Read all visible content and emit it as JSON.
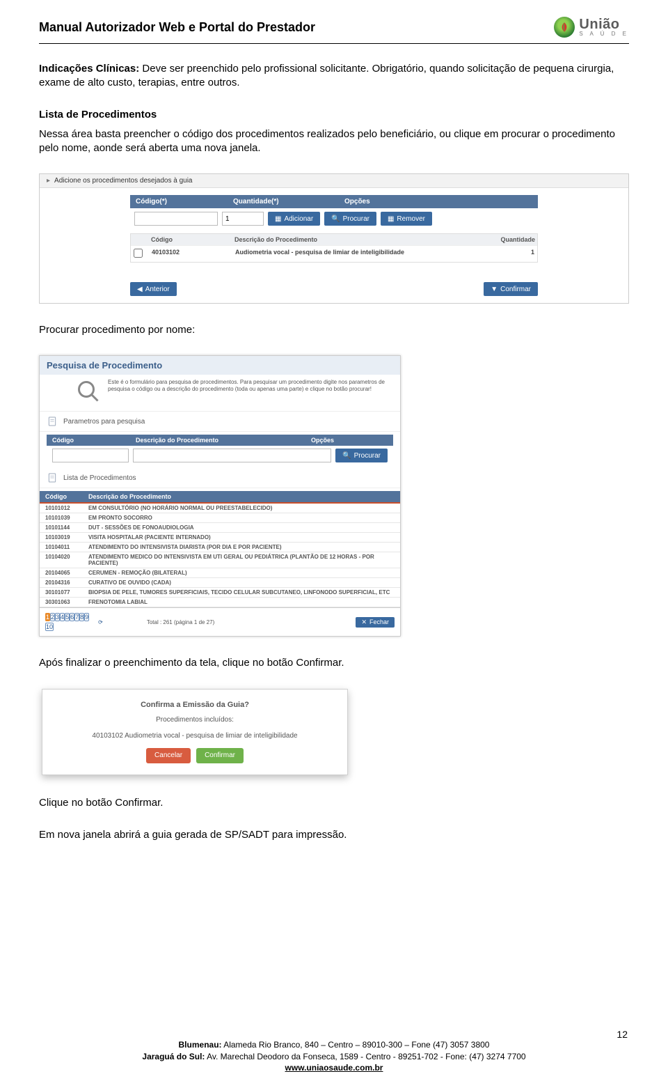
{
  "header": {
    "title": "Manual Autorizador Web e Portal do Prestador",
    "brand_name": "União",
    "brand_sub": "S A Ú D E"
  },
  "para1": {
    "label": "Indicações Clínicas:",
    "text": " Deve ser preenchido pelo profissional solicitante. Obrigatório, quando solicitação de pequena cirurgia, exame de alto custo, terapias, entre outros."
  },
  "h_lista": "Lista de Procedimentos",
  "para2": "Nessa área basta preencher o código dos procedimentos realizados pelo beneficiário, ou clique em procurar o procedimento pelo nome, aonde será aberta uma nova janela.",
  "shot1": {
    "bar": "Adicione os procedimentos desejados à guia",
    "th_codigo": "Código(*)",
    "th_qtd": "Quantidade(*)",
    "th_opc": "Opções",
    "default_qty": "1",
    "btn_add": "Adicionar",
    "btn_search": "Procurar",
    "btn_remove": "Remover",
    "sub_h0": "",
    "sub_h1": "Código",
    "sub_h2": "Descrição do Procedimento",
    "sub_h3": "Quantidade",
    "row_code": "40103102",
    "row_desc": "Audiometria vocal - pesquisa de limiar de inteligibilidade",
    "row_qty": "1",
    "btn_prev": "Anterior",
    "btn_next": "Confirmar"
  },
  "h_proc": "Procurar procedimento por nome:",
  "shot2": {
    "title": "Pesquisa de Procedimento",
    "desc": "Este é o formulário para pesquisa de procedimentos. Para pesquisar um procedimento digite nos parametros de pesquisa o código ou a descrição do procedimento (toda ou apenas uma parte) e clique no botão procurar!",
    "sec_params": "Parametros para pesquisa",
    "fh_a": "Código",
    "fh_b": "Descrição do Procedimento",
    "fh_c": "Opções",
    "btn_filter_search": "Procurar",
    "sec_list": "Lista de Procedimentos",
    "th_a": "Código",
    "th_b": "Descrição do Procedimento",
    "rows": [
      {
        "c": "10101012",
        "d": "EM CONSULTÓRIO (NO HORÁRIO NORMAL OU PREESTABELECIDO)"
      },
      {
        "c": "10101039",
        "d": "EM PRONTO SOCORRO"
      },
      {
        "c": "10101144",
        "d": "DUT - SESSÕES DE FONOAUDIOLOGIA"
      },
      {
        "c": "10103019",
        "d": "VISITA HOSPITALAR (PACIENTE INTERNADO)"
      },
      {
        "c": "10104011",
        "d": "ATENDIMENTO DO INTENSIVISTA DIARISTA (POR DIA E POR PACIENTE)"
      },
      {
        "c": "10104020",
        "d": "ATENDIMENTO MEDICO DO INTENSIVISTA EM UTI GERAL OU PEDIÁTRICA (PLANTÃO DE 12 HORAS - POR PACIENTE)"
      },
      {
        "c": "20104065",
        "d": "CERUMEN - REMOÇÃO (BILATERAL)"
      },
      {
        "c": "20104316",
        "d": "CURATIVO DE OUVIDO (CADA)"
      },
      {
        "c": "30101077",
        "d": "BIOPSIA DE PELE, TUMORES SUPERFICIAIS, TECIDO CELULAR SUBCUTANEO, LINFONODO SUPERFICIAL, ETC"
      },
      {
        "c": "30301063",
        "d": "FRENOTOMIA LABIAL"
      }
    ],
    "pages": [
      "1",
      "2",
      "3",
      "4",
      "5",
      "6",
      "7",
      "8",
      "9",
      "10"
    ],
    "total": "Total : 261 (página 1 de 27)",
    "btn_close": "Fechar"
  },
  "para3": "Após finalizar o preenchimento da tela, clique no botão Confirmar.",
  "shot3": {
    "q": "Confirma a Emissão da Guia?",
    "sub": "Procedimentos incluídos:",
    "line": "40103102 Audiometria vocal - pesquisa de limiar de inteligibilidade",
    "btn_cancel": "Cancelar",
    "btn_confirm": "Confirmar"
  },
  "para4": "Clique no botão Confirmar.",
  "para5": "Em nova janela abrirá a guia gerada de SP/SADT para impressão.",
  "page_num": "12",
  "footer": {
    "l1_pre": "Blumenau:",
    "l1_rest": " Alameda Rio Branco, 840 – Centro – 89010-300 – Fone (47) 3057 3800",
    "l2_pre": "Jaraguá do Sul:",
    "l2_rest": " Av. Marechal Deodoro da Fonseca, 1589 - Centro - 89251-702 - Fone: (47) 3274 7700",
    "l3": "www.uniaosaude.com.br"
  }
}
